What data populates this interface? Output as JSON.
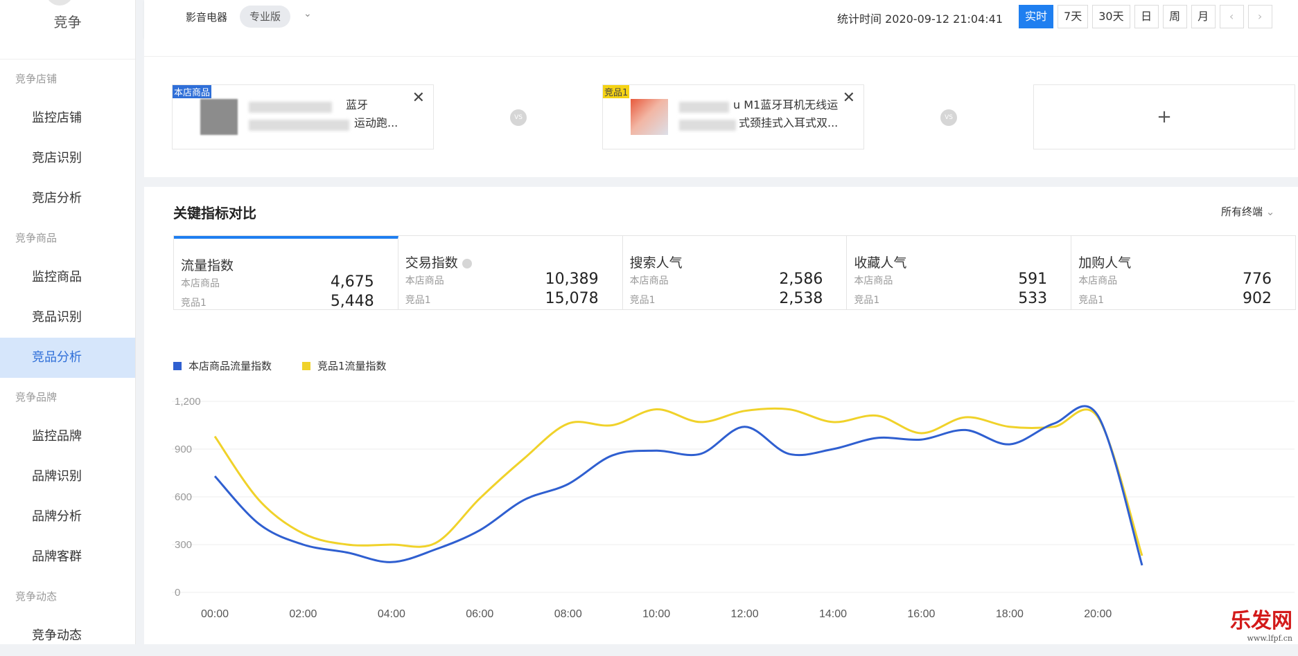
{
  "sidebar": {
    "title": "竞争",
    "groups": [
      {
        "label": "竞争店铺",
        "items": [
          "监控店铺",
          "竞店识别",
          "竞店分析"
        ]
      },
      {
        "label": "竞争商品",
        "items": [
          "监控商品",
          "竞品识别",
          "竞品分析"
        ]
      },
      {
        "label": "竞争品牌",
        "items": [
          "监控品牌",
          "品牌识别",
          "品牌分析",
          "品牌客群"
        ]
      },
      {
        "label": "竞争动态",
        "items": [
          "竞争动态"
        ]
      }
    ],
    "active": "竞品分析"
  },
  "topbar": {
    "category": "影音电器",
    "version": "专业版",
    "stat_time": "统计时间 2020-09-12 21:04:41",
    "buttons": [
      "实时",
      "7天",
      "30天",
      "日",
      "周",
      "月"
    ],
    "active_button": "实时",
    "prev": "‹",
    "next": "›"
  },
  "compare": {
    "own": {
      "tag": "本店商品",
      "line1": "蓝牙",
      "line2": "运动跑..."
    },
    "rival": {
      "tag": "竞品1",
      "line1": "u M1蓝牙耳机无线运",
      "line2": "式颈挂式入耳式双..."
    },
    "vs": "VS",
    "add": "+"
  },
  "metrics_card": {
    "title": "关键指标对比",
    "filter": "所有终端",
    "tabs": [
      {
        "name": "流量指数",
        "own_label": "本店商品",
        "own": "4,675",
        "rival_label": "竞品1",
        "rival": "5,448"
      },
      {
        "name": "交易指数",
        "own_label": "本店商品",
        "own": "10,389",
        "rival_label": "竞品1",
        "rival": "15,078"
      },
      {
        "name": "搜索人气",
        "own_label": "本店商品",
        "own": "2,586",
        "rival_label": "竞品1",
        "rival": "2,538"
      },
      {
        "name": "收藏人气",
        "own_label": "本店商品",
        "own": "591",
        "rival_label": "竞品1",
        "rival": "533"
      },
      {
        "name": "加购人气",
        "own_label": "本店商品",
        "own": "776",
        "rival_label": "竞品1",
        "rival": "902"
      }
    ]
  },
  "colors": {
    "own": "#2f5fd0",
    "rival": "#f0d22a",
    "accent": "#1f7ff0"
  },
  "watermark": {
    "text": "乐发网",
    "url": "www.lfpf.cn"
  },
  "chart_data": {
    "type": "line",
    "x": [
      "00:00",
      "01:00",
      "02:00",
      "03:00",
      "04:00",
      "05:00",
      "06:00",
      "07:00",
      "08:00",
      "09:00",
      "10:00",
      "11:00",
      "12:00",
      "13:00",
      "14:00",
      "15:00",
      "16:00",
      "17:00",
      "18:00",
      "19:00",
      "20:00",
      "21:00"
    ],
    "x_ticks": [
      "00:00",
      "02:00",
      "04:00",
      "06:00",
      "08:00",
      "10:00",
      "12:00",
      "14:00",
      "16:00",
      "18:00",
      "20:00"
    ],
    "y_ticks": [
      "0",
      "300",
      "600",
      "900",
      "1,200"
    ],
    "ylim": [
      0,
      1200
    ],
    "series": [
      {
        "name": "本店商品流量指数",
        "values": [
          730,
          430,
          300,
          250,
          190,
          270,
          390,
          580,
          680,
          860,
          890,
          870,
          1040,
          870,
          900,
          970,
          960,
          1020,
          930,
          1060,
          1110,
          170
        ]
      },
      {
        "name": "竞品1流量指数",
        "values": [
          980,
          580,
          370,
          300,
          300,
          310,
          590,
          840,
          1060,
          1050,
          1150,
          1070,
          1140,
          1150,
          1070,
          1110,
          1000,
          1100,
          1040,
          1040,
          1100,
          230
        ]
      }
    ]
  }
}
